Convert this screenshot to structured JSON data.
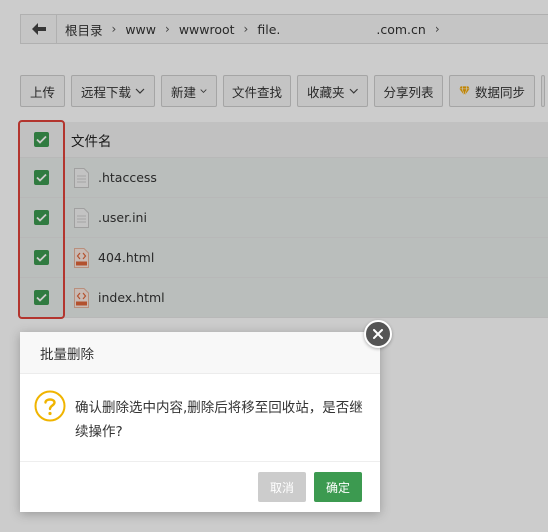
{
  "breadcrumb": {
    "items": [
      "根目录",
      "www",
      "wwwroot",
      "file.",
      ".com.cn"
    ],
    "back_icon": "arrow-left-icon"
  },
  "toolbar": {
    "upload": "上传",
    "remote_download": "远程下载",
    "new": "新建",
    "file_search": "文件查找",
    "favorites": "收藏夹",
    "share_list": "分享列表",
    "data_sync": "数据同步"
  },
  "file_table": {
    "header": "文件名",
    "files": [
      {
        "name": ".htaccess",
        "icon": "text-file-icon",
        "checked": true
      },
      {
        "name": ".user.ini",
        "icon": "text-file-icon",
        "checked": true
      },
      {
        "name": "404.html",
        "icon": "html-file-icon",
        "checked": true
      },
      {
        "name": "index.html",
        "icon": "html-file-icon",
        "checked": true
      }
    ]
  },
  "dialog": {
    "title": "批量删除",
    "message": "确认删除选中内容,删除后将移至回收站，是否继续操作?",
    "cancel": "取消",
    "confirm": "确定"
  },
  "colors": {
    "accent": "#3c9a50",
    "highlight_outline": "#e0433a",
    "warning": "#f0b400"
  }
}
